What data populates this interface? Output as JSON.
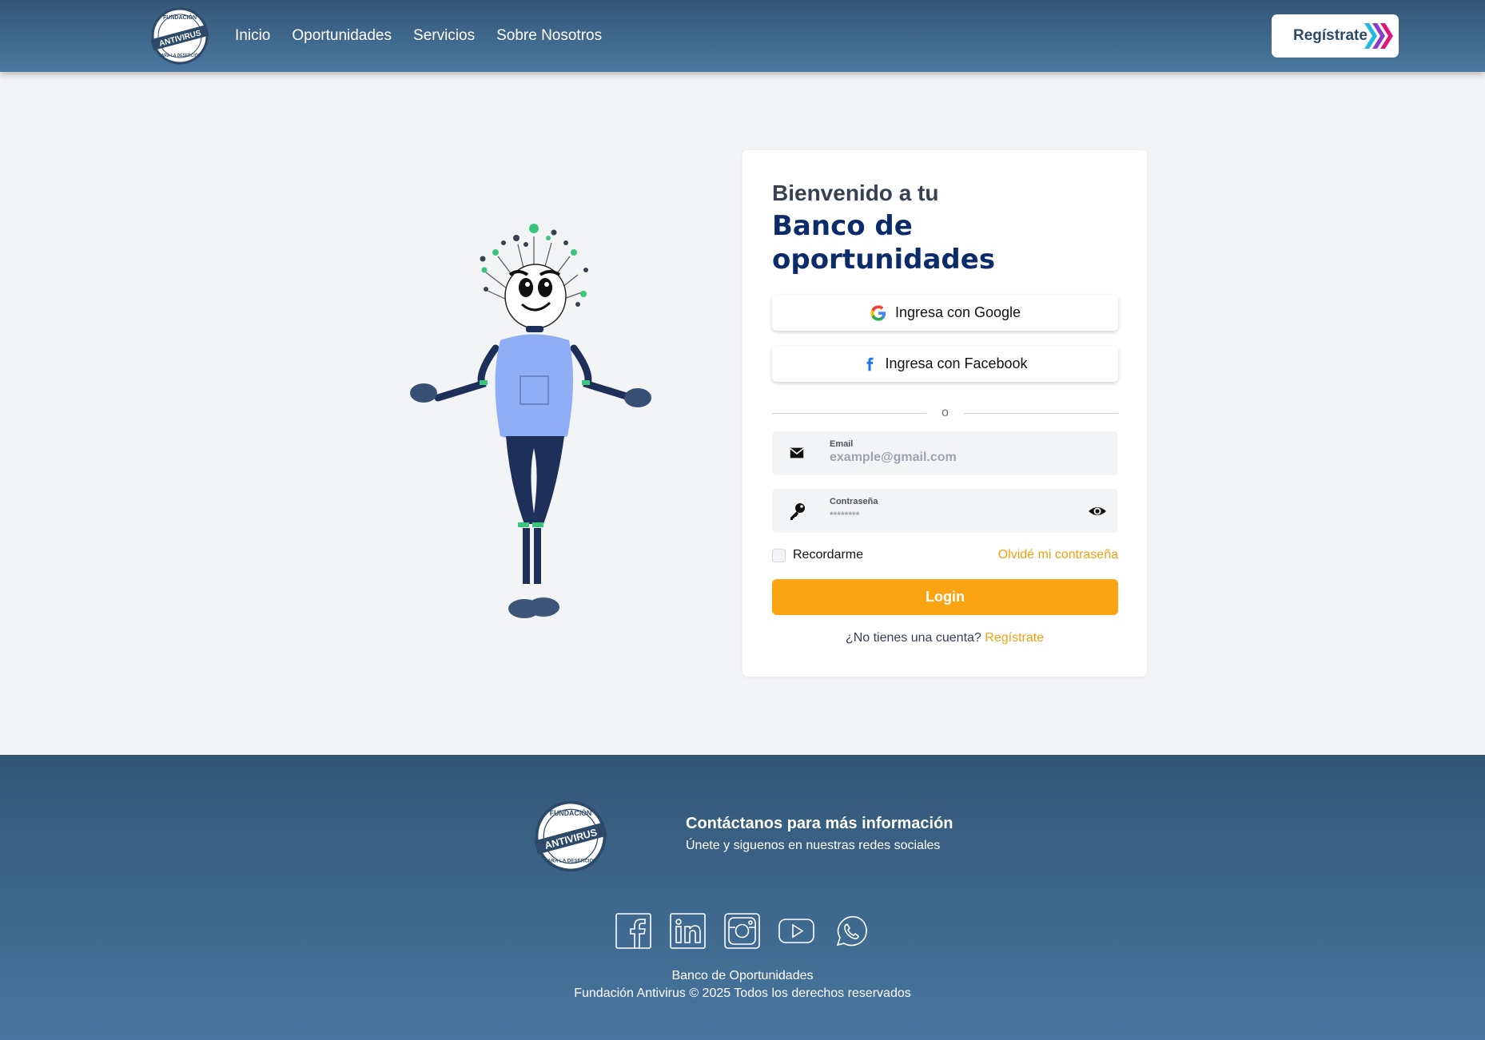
{
  "header": {
    "nav": [
      "Inicio",
      "Oportunidades",
      "Servicios",
      "Sobre Nosotros"
    ],
    "register_button": "Regístrate"
  },
  "logo": {
    "top_text": "FUNDACIÓN",
    "band_text": "ANTIVIRUS",
    "bottom_text": "PARA LA DESERCIÓN"
  },
  "login": {
    "welcome": "Bienvenido a tu",
    "title": "Banco de oportunidades",
    "google_button": "Ingresa con Google",
    "facebook_button": "Ingresa con Facebook",
    "divider": "o",
    "email_label": "Email",
    "email_placeholder": "example@gmail.com",
    "password_label": "Contraseña",
    "password_placeholder": "********",
    "remember": "Recordarme",
    "forgot": "Olvidé mi contraseña",
    "login_button": "Login",
    "no_account": "¿No tienes una cuenta?",
    "register_link": "Regístrate"
  },
  "footer": {
    "heading": "Contáctanos para más información",
    "subheading": "Únete y siguenos en nuestras redes sociales",
    "social_icons": [
      "facebook-icon",
      "linkedin-icon",
      "instagram-icon",
      "youtube-icon",
      "whatsapp-icon"
    ],
    "line1": "Banco de Oportunidades",
    "line2": "Fundación Antivirus © 2025 Todos los derechos reservados"
  },
  "colors": {
    "primary": "#fba311",
    "header": "#3f6a90",
    "title": "#0b2b6a"
  }
}
